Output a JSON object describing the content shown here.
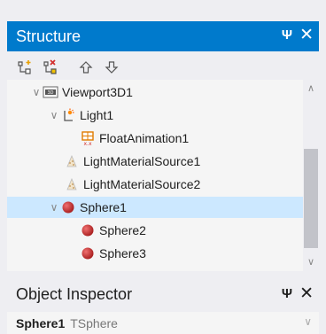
{
  "structure_panel": {
    "title": "Structure",
    "pin_glyph": "Ψ",
    "close_glyph": "✕"
  },
  "toolbar": {
    "buttons": [
      {
        "name": "add-item-icon"
      },
      {
        "name": "delete-item-icon"
      },
      {
        "name": "move-up-icon"
      },
      {
        "name": "move-down-icon"
      }
    ]
  },
  "tree": {
    "items": [
      {
        "label": "Viewport3D1",
        "icon": "viewport3d-icon",
        "expanded": true,
        "selected": false
      },
      {
        "label": "Light1",
        "icon": "light-icon",
        "expanded": true,
        "selected": false
      },
      {
        "label": "FloatAnimation1",
        "icon": "float-animation-icon",
        "selected": false
      },
      {
        "label": "LightMaterialSource1",
        "icon": "light-material-icon",
        "selected": false
      },
      {
        "label": "LightMaterialSource2",
        "icon": "light-material-icon",
        "selected": false
      },
      {
        "label": "Sphere1",
        "icon": "sphere-icon",
        "expanded": true,
        "selected": true
      },
      {
        "label": "Sphere2",
        "icon": "sphere-icon",
        "selected": false
      },
      {
        "label": "Sphere3",
        "icon": "sphere-icon",
        "selected": false
      }
    ]
  },
  "object_inspector": {
    "title": "Object Inspector",
    "pin_glyph": "Ψ",
    "close_glyph": "✕",
    "selected_name": "Sphere1",
    "selected_type": "TSphere"
  },
  "colors": {
    "header_blue": "#007acc",
    "selection": "#cce8ff"
  }
}
